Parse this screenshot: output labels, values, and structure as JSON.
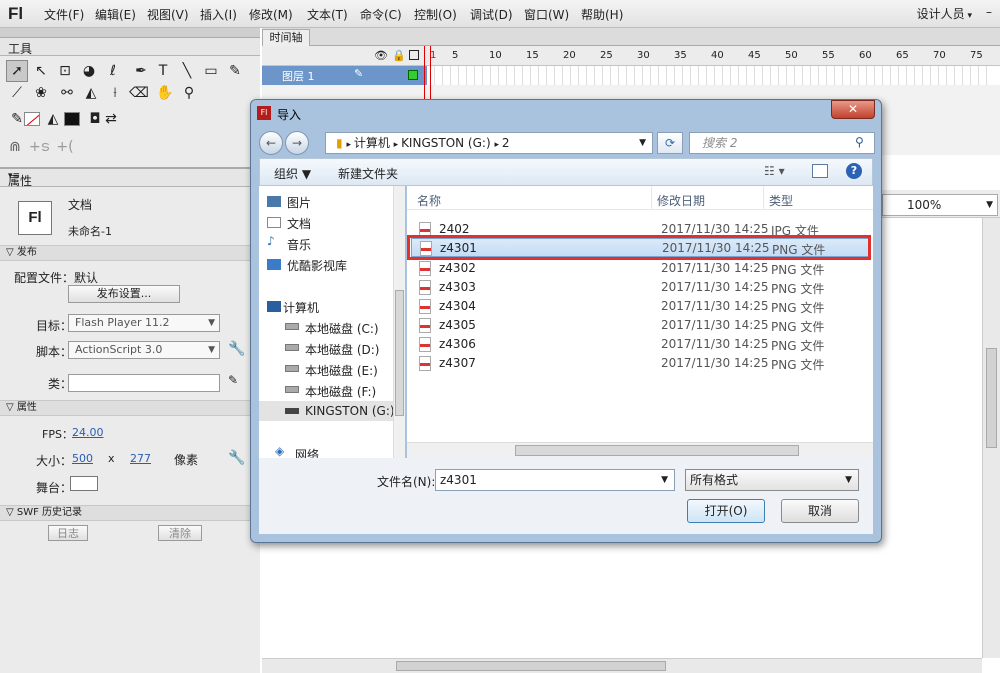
{
  "app": {
    "logo": "Fl"
  },
  "menu": [
    "文件(F)",
    "编辑(E)",
    "视图(V)",
    "插入(I)",
    "修改(M)",
    "文本(T)",
    "命令(C)",
    "控制(O)",
    "调试(D)",
    "窗口(W)",
    "帮助(H)"
  ],
  "workspace": {
    "label": "设计人员",
    "min": "–"
  },
  "tools_panel": {
    "title": "工具"
  },
  "properties": {
    "title": "属性",
    "doc_type": "文档",
    "doc_name": "未命名-1",
    "publish_section": "发布",
    "profile_label": "配置文件：默认",
    "publish_settings_button": "发布设置...",
    "target_label": "目标：",
    "target_value": "Flash Player 11.2",
    "script_label": "脚本：",
    "script_value": "ActionScript 3.0",
    "class_label": "类：",
    "props_section": "属性",
    "fps_label": "FPS：",
    "fps_value": "24.00",
    "size_label": "大小：",
    "width": "500",
    "x": "x",
    "height": "277",
    "unit": "像素",
    "stage_label": "舞台：",
    "swf_section": "SWF 历史记录",
    "log_button": "日志",
    "clear_button": "清除"
  },
  "timeline": {
    "tab": "时间轴",
    "layer_name": "图层 1",
    "frame_numbers": [
      "1",
      "5",
      "10",
      "15",
      "20",
      "25",
      "30",
      "35",
      "40",
      "45",
      "50",
      "55",
      "60",
      "65",
      "70",
      "75"
    ]
  },
  "stage": {
    "zoom": "100%"
  },
  "dialog": {
    "title": "导入",
    "breadcrumb": [
      "计算机",
      "KINGSTON (G:)",
      "2"
    ],
    "search_placeholder": "搜索 2",
    "organize": "组织 ▼",
    "new_folder": "新建文件夹",
    "nav": [
      "图片",
      "文档",
      "音乐",
      "优酷影视库",
      "计算机",
      "本地磁盘 (C:)",
      "本地磁盘 (D:)",
      "本地磁盘 (E:)",
      "本地磁盘 (F:)",
      "KINGSTON (G:)",
      "网络"
    ],
    "columns": {
      "name": "名称",
      "date": "修改日期",
      "type": "类型"
    },
    "files": [
      {
        "name": "2402",
        "date": "2017/11/30 14:25",
        "type": "JPG 文件"
      },
      {
        "name": "z4301",
        "date": "2017/11/30 14:25",
        "type": "PNG 文件"
      },
      {
        "name": "z4302",
        "date": "2017/11/30 14:25",
        "type": "PNG 文件"
      },
      {
        "name": "z4303",
        "date": "2017/11/30 14:25",
        "type": "PNG 文件"
      },
      {
        "name": "z4304",
        "date": "2017/11/30 14:25",
        "type": "PNG 文件"
      },
      {
        "name": "z4305",
        "date": "2017/11/30 14:25",
        "type": "PNG 文件"
      },
      {
        "name": "z4306",
        "date": "2017/11/30 14:25",
        "type": "PNG 文件"
      },
      {
        "name": "z4307",
        "date": "2017/11/30 14:25",
        "type": "PNG 文件"
      }
    ],
    "filename_label": "文件名(N):",
    "filename_value": "z4301",
    "filter_value": "所有格式",
    "open_button": "打开(O)",
    "cancel_button": "取消"
  },
  "colors": {
    "accent": "#6c95c9",
    "highlight": "#e03030"
  }
}
